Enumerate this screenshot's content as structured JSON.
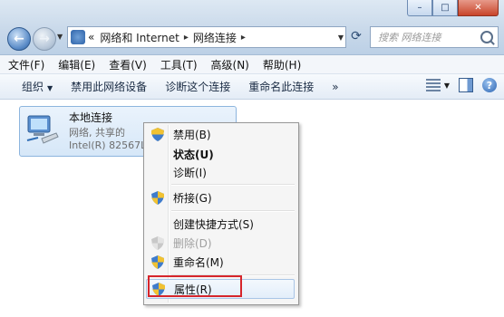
{
  "window": {
    "controls": [
      "–",
      "□",
      "✕"
    ]
  },
  "address": {
    "prefix": "«",
    "crumbs": [
      "网络和 Internet",
      "网络连接"
    ],
    "sep": "▸"
  },
  "search": {
    "placeholder": "搜索 网络连接"
  },
  "menubar": {
    "items": [
      "文件(F)",
      "编辑(E)",
      "查看(V)",
      "工具(T)",
      "高级(N)",
      "帮助(H)"
    ]
  },
  "cmdbar": {
    "organize": "组织",
    "items": [
      "禁用此网络设备",
      "诊断这个连接",
      "重命名此连接"
    ],
    "more": "»"
  },
  "connection": {
    "name": "本地连接",
    "status": "网络, 共享的",
    "device": "Intel(R) 82567LM"
  },
  "context_menu": {
    "items": [
      {
        "label": "禁用(B)",
        "shield": true
      },
      {
        "label": "状态(U)",
        "bold": true
      },
      {
        "label": "诊断(I)"
      },
      {
        "label": "桥接(G)",
        "shield": true
      },
      {
        "label": "创建快捷方式(S)"
      },
      {
        "label": "删除(D)",
        "shield": true,
        "disabled": true
      },
      {
        "label": "重命名(M)",
        "shield": true
      },
      {
        "label": "属性(R)",
        "shield": true,
        "highlighted": true
      }
    ]
  },
  "colors": {
    "accent": "#d6252b",
    "selection": "#d6e7f8"
  }
}
